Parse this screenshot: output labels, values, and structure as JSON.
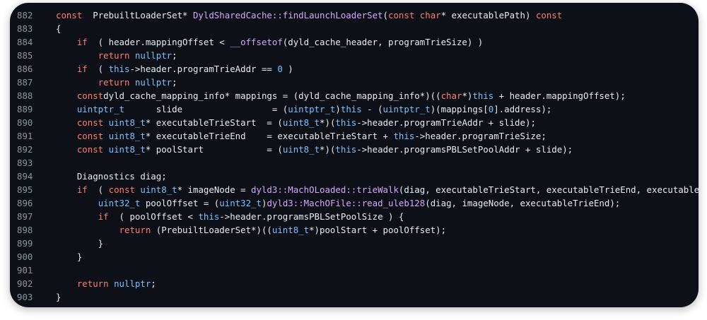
{
  "colors": {
    "background": "#0d1117",
    "text": "#e6edf3",
    "line_number": "#8b949e",
    "keyword": "#ff7b72",
    "type": "#79c0ff",
    "function": "#d2a8ff"
  },
  "lines": [
    {
      "n": "882",
      "tokens": [
        [
          "kw",
          "const"
        ],
        [
          "",
          "  PrebuiltLoaderSet* "
        ],
        [
          "fn",
          "DyldSharedCache::findLaunchLoaderSet"
        ],
        [
          "",
          "("
        ],
        [
          "kw",
          "const"
        ],
        [
          "",
          ""
        ],
        [
          "kw",
          " char"
        ],
        [
          "",
          "* executablePath) "
        ],
        [
          "kw",
          "const"
        ]
      ]
    },
    {
      "n": "883",
      "tokens": [
        [
          "",
          "{"
        ]
      ]
    },
    {
      "n": "884",
      "tokens": [
        [
          "",
          "    "
        ],
        [
          "kw",
          "if"
        ],
        [
          "",
          "  ( header.mappingOffset < "
        ],
        [
          "fn",
          "__offsetof"
        ],
        [
          "",
          "(dyld_cache_header, programTrieSize) )"
        ]
      ]
    },
    {
      "n": "885",
      "tokens": [
        [
          "",
          "        "
        ],
        [
          "kw",
          "return"
        ],
        [
          "",
          ""
        ],
        [
          "ty",
          " nullptr"
        ],
        [
          "",
          ";"
        ]
      ]
    },
    {
      "n": "886",
      "tokens": [
        [
          "",
          "    "
        ],
        [
          "kw",
          "if"
        ],
        [
          "",
          "  ( "
        ],
        [
          "ty",
          "this"
        ],
        [
          "",
          "->header.programTrieAddr == "
        ],
        [
          "nm",
          "0"
        ],
        [
          "",
          " )"
        ]
      ]
    },
    {
      "n": "887",
      "tokens": [
        [
          "",
          "        "
        ],
        [
          "kw",
          "return"
        ],
        [
          "",
          ""
        ],
        [
          "ty",
          " nullptr"
        ],
        [
          "",
          ";"
        ]
      ]
    },
    {
      "n": "888",
      "tokens": [
        [
          "",
          "    "
        ],
        [
          "kw",
          "const"
        ],
        [
          "",
          "",
          " "
        ],
        [
          "",
          "dyld_cache_mapping_info* mappings = (dyld_cache_mapping_info*)(("
        ],
        [
          "kw",
          "char"
        ],
        [
          "",
          "*)"
        ],
        [
          "ty",
          "this"
        ],
        [
          "",
          " + header.mappingOffset);"
        ]
      ]
    },
    {
      "n": "889",
      "tokens": [
        [
          "",
          "    "
        ],
        [
          "ty",
          "uintptr_t"
        ],
        [
          "",
          "      slide                 = ("
        ],
        [
          "ty",
          "uintptr_t"
        ],
        [
          "",
          ")"
        ],
        [
          "ty",
          "this"
        ],
        [
          "",
          " - ("
        ],
        [
          "ty",
          "uintptr_t"
        ],
        [
          "",
          ")(mappings["
        ],
        [
          "nm",
          "0"
        ],
        [
          "",
          "].address);"
        ]
      ]
    },
    {
      "n": "890",
      "tokens": [
        [
          "",
          "    "
        ],
        [
          "kw",
          "const"
        ],
        [
          "",
          ""
        ],
        [
          "ty",
          " uint8_t"
        ],
        [
          "",
          "* executableTrieStart  = ("
        ],
        [
          "ty",
          "uint8_t"
        ],
        [
          "",
          "*)("
        ],
        [
          "ty",
          "this"
        ],
        [
          "",
          "->header.programTrieAddr + slide);"
        ]
      ]
    },
    {
      "n": "891",
      "tokens": [
        [
          "",
          "    "
        ],
        [
          "kw",
          "const"
        ],
        [
          "",
          ""
        ],
        [
          "ty",
          " uint8_t"
        ],
        [
          "",
          "* executableTrieEnd    = executableTrieStart + "
        ],
        [
          "ty",
          "this"
        ],
        [
          "",
          "->header.programTrieSize;"
        ]
      ]
    },
    {
      "n": "892",
      "tokens": [
        [
          "",
          "    "
        ],
        [
          "kw",
          "const"
        ],
        [
          "",
          ""
        ],
        [
          "ty",
          " uint8_t"
        ],
        [
          "",
          "* poolStart            = ("
        ],
        [
          "ty",
          "uint8_t"
        ],
        [
          "",
          "*)("
        ],
        [
          "ty",
          "this"
        ],
        [
          "",
          "->header.programsPBLSetPoolAddr + slide);"
        ]
      ]
    },
    {
      "n": "893",
      "tokens": [
        [
          "",
          ""
        ]
      ]
    },
    {
      "n": "894",
      "tokens": [
        [
          "",
          "    Diagnostics diag;"
        ]
      ]
    },
    {
      "n": "895",
      "tokens": [
        [
          "",
          "    "
        ],
        [
          "kw",
          "if"
        ],
        [
          "",
          "  ( "
        ],
        [
          "kw",
          "const"
        ],
        [
          "",
          ""
        ],
        [
          "ty",
          " uint8_t"
        ],
        [
          "",
          "* imageNode = "
        ],
        [
          "fn",
          "dyld3::MachOLoaded::trieWalk"
        ],
        [
          "",
          "(diag, executableTrieStart, executableTrieEnd, executablePath) ) {"
        ]
      ]
    },
    {
      "n": "896",
      "tokens": [
        [
          "",
          "        "
        ],
        [
          "ty",
          "uint32_t"
        ],
        [
          "",
          " poolOffset = ("
        ],
        [
          "ty",
          "uint32_t"
        ],
        [
          "",
          ")"
        ],
        [
          "fn",
          "dyld3::MachOFile::read_uleb128"
        ],
        [
          "",
          "(diag, imageNode, executableTrieEnd);"
        ]
      ]
    },
    {
      "n": "897",
      "tokens": [
        [
          "",
          "        "
        ],
        [
          "kw",
          "if"
        ],
        [
          "",
          "  ( poolOffset < "
        ],
        [
          "ty",
          "this"
        ],
        [
          "",
          "->header.programsPBLSetPoolSize ) {"
        ]
      ]
    },
    {
      "n": "898",
      "tokens": [
        [
          "",
          "            "
        ],
        [
          "kw",
          "return"
        ],
        [
          "",
          " (PrebuiltLoaderSet*)(("
        ],
        [
          "ty",
          "uint8_t"
        ],
        [
          "",
          "*)poolStart + poolOffset);"
        ]
      ]
    },
    {
      "n": "899",
      "tokens": [
        [
          "",
          "        }"
        ]
      ]
    },
    {
      "n": "900",
      "tokens": [
        [
          "",
          "    }"
        ]
      ]
    },
    {
      "n": "901",
      "tokens": [
        [
          "",
          ""
        ]
      ]
    },
    {
      "n": "902",
      "tokens": [
        [
          "",
          "    "
        ],
        [
          "kw",
          "return"
        ],
        [
          "",
          ""
        ],
        [
          "ty",
          " nullptr"
        ],
        [
          "",
          ";"
        ]
      ]
    },
    {
      "n": "903",
      "tokens": [
        [
          "",
          "}"
        ]
      ]
    }
  ]
}
